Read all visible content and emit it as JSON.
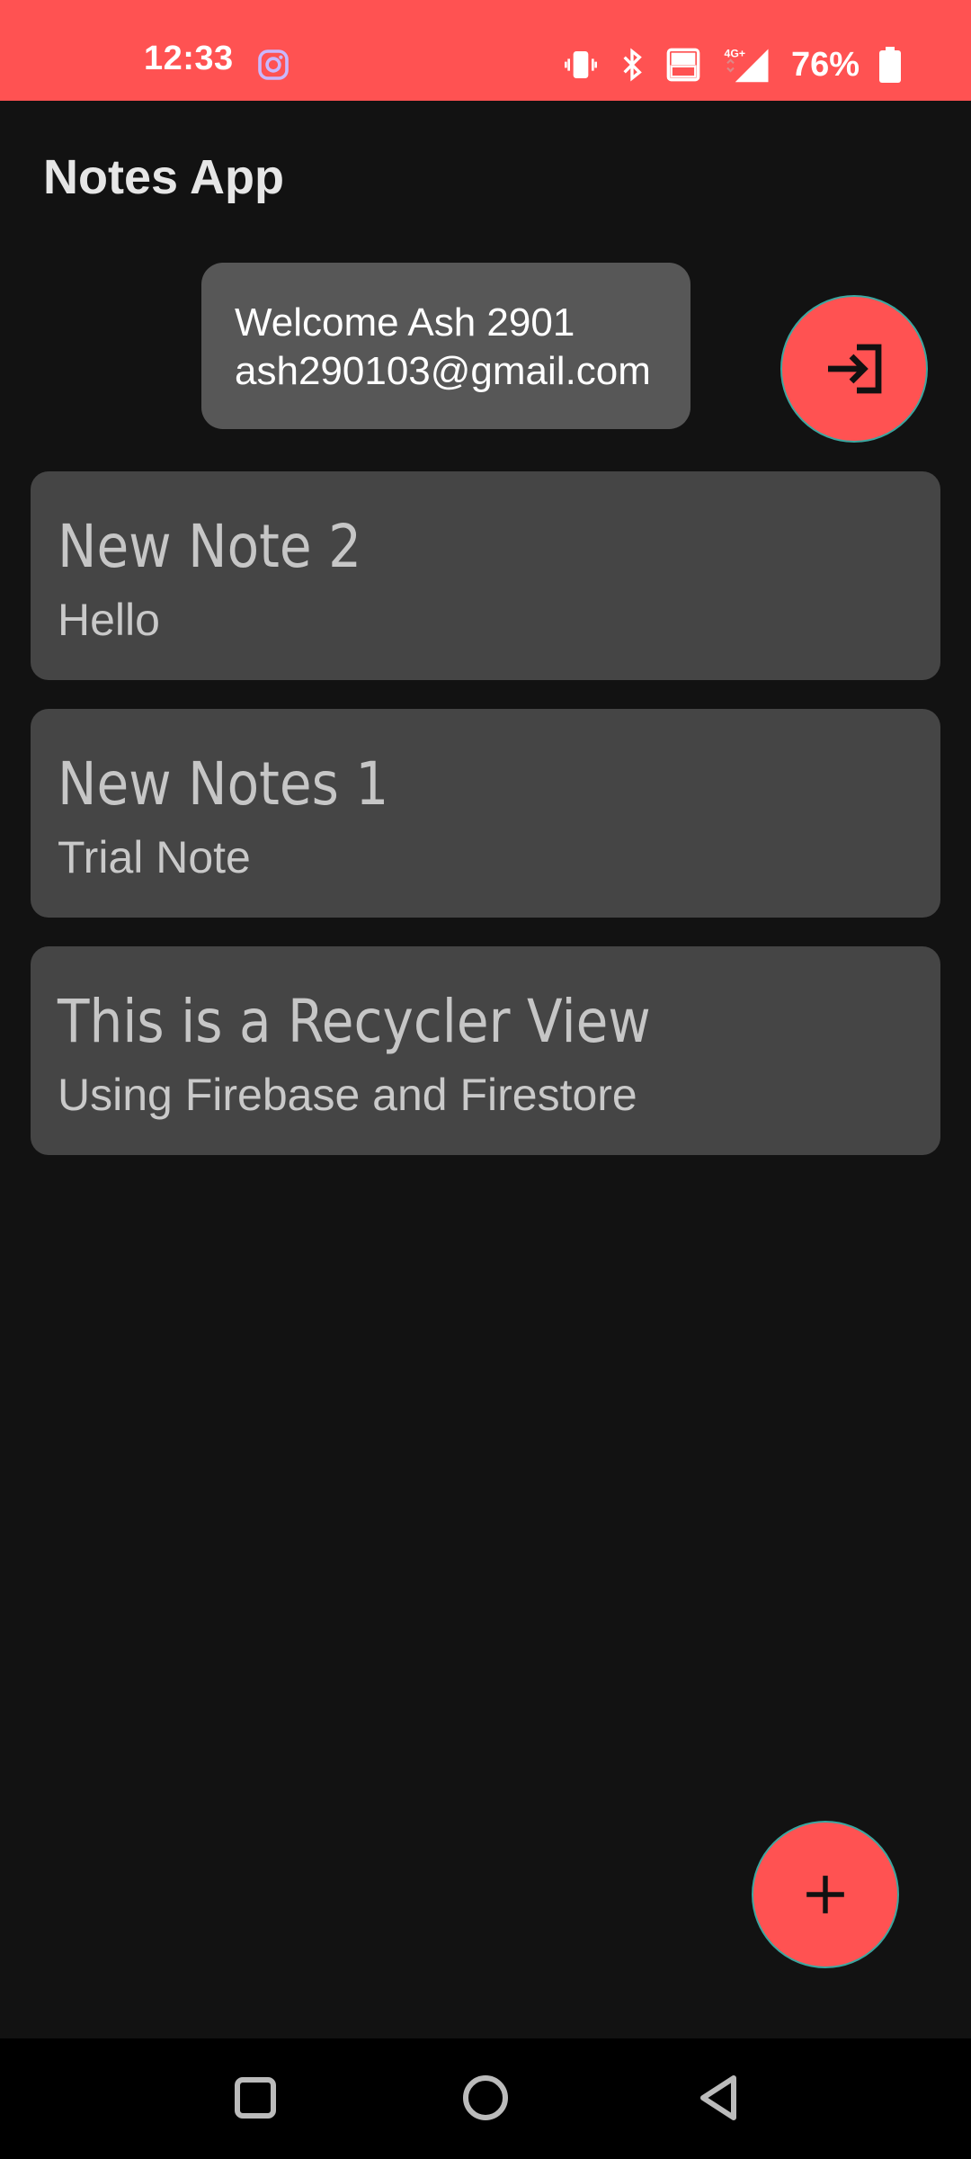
{
  "status_bar": {
    "time": "12:33",
    "battery": "76%",
    "icons": [
      "instagram-icon",
      "vibrate-icon",
      "bluetooth-icon",
      "volte-icon",
      "4g-signal-icon",
      "battery-icon"
    ],
    "background": "#FF5252"
  },
  "app": {
    "title": "Notes App"
  },
  "welcome": {
    "line1": "Welcome Ash 2901",
    "line2": "ash290103@gmail.com"
  },
  "notes": [
    {
      "title": "New Note 2",
      "content": "Hello"
    },
    {
      "title": "New Notes 1",
      "content": "Trial Note"
    },
    {
      "title": "This is a Recycler View",
      "content": "Using Firebase and Firestore"
    }
  ],
  "buttons": {
    "logout_icon": "login-arrow-icon",
    "add_icon": "plus-icon"
  },
  "nav": {
    "icons": [
      "recents-square-icon",
      "home-circle-icon",
      "back-triangle-icon"
    ]
  },
  "colors": {
    "accent": "#FF5252",
    "background": "#121212",
    "card": "#454545",
    "welcome_card": "#575757"
  }
}
